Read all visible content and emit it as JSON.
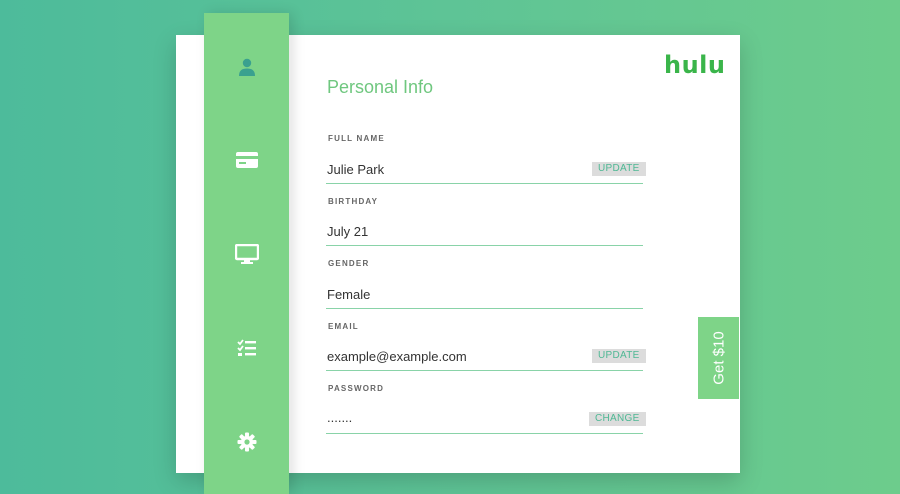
{
  "brand": {
    "logo_text": "hulu",
    "accent": "#3ab54a",
    "sidebar_color": "#7ed488"
  },
  "sidebar": {
    "items": [
      {
        "icon": "user-icon"
      },
      {
        "icon": "credit-card-icon"
      },
      {
        "icon": "monitor-icon"
      },
      {
        "icon": "checklist-icon"
      },
      {
        "icon": "gear-icon"
      }
    ]
  },
  "page": {
    "title": "Personal Info"
  },
  "fields": {
    "full_name": {
      "label": "FULL NAME",
      "value": "Julie Park",
      "action": "UPDATE"
    },
    "birthday": {
      "label": "BIRTHDAY",
      "value": "July 21"
    },
    "gender": {
      "label": "GENDER",
      "value": "Female"
    },
    "email": {
      "label": "EMAIL",
      "value": "example@example.com",
      "action": "UPDATE"
    },
    "password": {
      "label": "PASSWORD",
      "value": ".......",
      "action": "CHANGE"
    }
  },
  "promo": {
    "label": "Get $10"
  }
}
